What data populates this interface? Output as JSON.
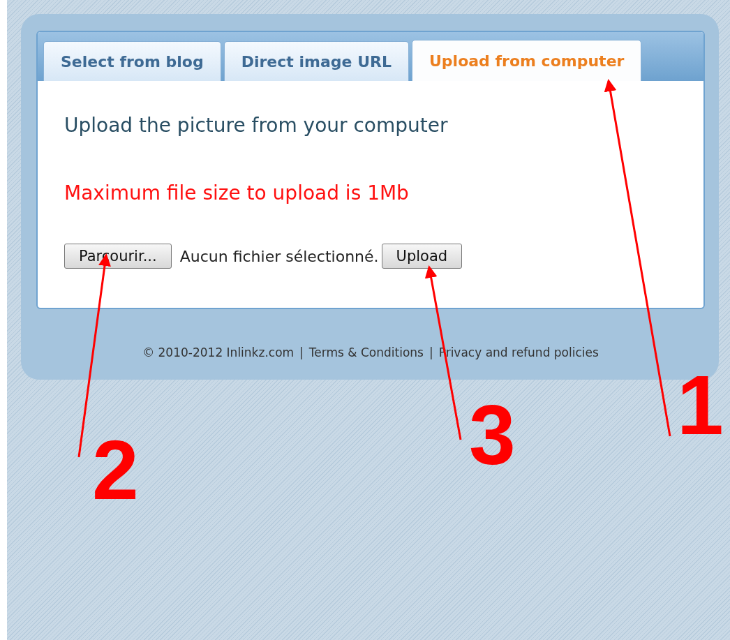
{
  "tabs": [
    {
      "label": "Select from blog",
      "selected": false
    },
    {
      "label": "Direct image URL",
      "selected": false
    },
    {
      "label": "Upload from computer",
      "selected": true
    }
  ],
  "heading": "Upload the picture from your computer",
  "notice": "Maximum file size to upload is 1Mb",
  "file_input": {
    "button": "Parcourir...",
    "status": "Aucun fichier sélectionné."
  },
  "upload_button": "Upload",
  "footer": {
    "copyright": "© 2010-2012 Inlinkz.com",
    "links": [
      {
        "separator": "|",
        "label": "Terms & Conditions"
      },
      {
        "separator": "|",
        "label": "Privacy and refund policies"
      }
    ]
  },
  "annotations": [
    {
      "label": "1"
    },
    {
      "label": "2"
    },
    {
      "label": "3"
    }
  ]
}
